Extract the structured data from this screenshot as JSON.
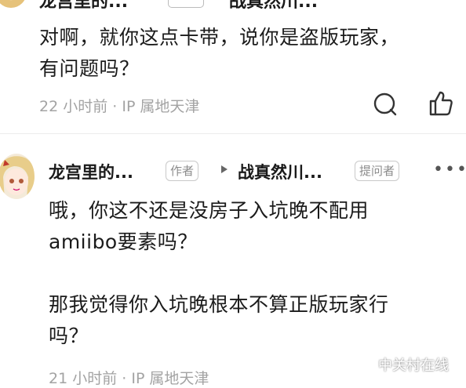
{
  "comment1": {
    "author": "龙宫里的...",
    "reply_to": "战真然川...",
    "text_line1": "对啊，就你这点卡带，说你是盗版玩家，",
    "text_line2": "有问题吗？",
    "meta": "22 小时前 · IP 属地天津"
  },
  "comment2": {
    "author": "龙宫里的...",
    "author_tag": "作者",
    "reply_to": "战真然川...",
    "reply_tag": "提问者",
    "more": "•••",
    "text_line1": "哦，你这不还是没房子入坑晚不配用",
    "text_line2": "amiibo要素吗？",
    "text_line3": "那我觉得你入坑晚根本不算正版玩家行",
    "text_line4": "吗？",
    "meta": "21 小时前 · IP 属地天津"
  },
  "watermark": "中关村在线",
  "icons": [
    "comment-icon",
    "like-icon",
    "more-icon",
    "triangle-right-icon"
  ],
  "colors": {
    "text": "#1a1a1a",
    "meta": "#a3a3a3",
    "tag_border": "#c9c9c9"
  }
}
